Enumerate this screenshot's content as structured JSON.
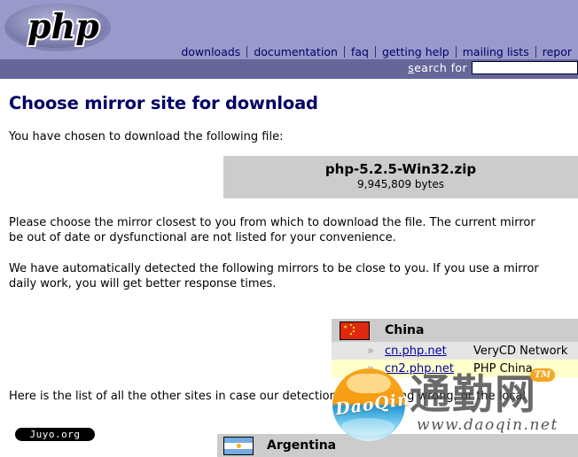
{
  "header": {
    "logo_text": "php",
    "nav_items": [
      {
        "label": "downloads"
      },
      {
        "label": "documentation"
      },
      {
        "label": "faq"
      },
      {
        "label": "getting help"
      },
      {
        "label": "mailing lists"
      },
      {
        "label": "repor"
      }
    ],
    "search_label_accesskey": "s",
    "search_label_rest": "earch for",
    "search_value": "",
    "search_placeholder": "",
    "band_color": "#9999cc",
    "search_band_color": "#666699"
  },
  "page": {
    "title": "Choose mirror site for download",
    "title_color": "#000066",
    "intro": "You have chosen to download the following file:",
    "paragraph_1": "Please choose the mirror closest to you from which to download the file. The current mirror",
    "paragraph_1b": "be out of date or dysfunctional are not listed for your convenience.",
    "paragraph_2": "We have automatically detected the following mirrors to be close to you. If you use a mirror",
    "paragraph_2b": "daily work, you will get better response times.",
    "paragraph_3": "Here is the list of all the other sites in case our detection is something wrong, or the local"
  },
  "file_box": {
    "name": "php-5.2.5-Win32.zip",
    "size": "9,945,809 bytes",
    "background": "#cccccc"
  },
  "mirrors": {
    "detected": {
      "country": "China",
      "flag": "cn-flag-icon",
      "rows": [
        {
          "arrow": "»",
          "host": "cn.php.net",
          "provider": "VeryCD Network",
          "row_style": "gray"
        },
        {
          "arrow": "»",
          "host": "cn2.php.net",
          "provider": "PHP China",
          "row_style": "yellow"
        }
      ]
    },
    "all_sites": {
      "country": "Argentina",
      "flag": "ar-flag-icon",
      "rows": []
    }
  },
  "watermark": {
    "brand": "DaoQin",
    "cjk": "通勤网",
    "tm": "TM",
    "url": "www.daoqin.net",
    "sphere_top_color": "#f5a623",
    "sphere_bottom_color": "#2196d6"
  },
  "badge": {
    "label": "Juyo.org"
  }
}
